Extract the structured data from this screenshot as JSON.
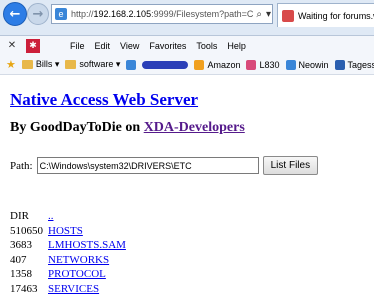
{
  "browser": {
    "url_prefix": "http://",
    "url_host": "192.168.2.105",
    "url_rest": ":9999/Filesystem?path=C",
    "tab_title": "Waiting for forums.windr"
  },
  "menu": {
    "items": [
      "File",
      "Edit",
      "View",
      "Favorites",
      "Tools",
      "Help"
    ]
  },
  "favorites": {
    "items": [
      {
        "label": "Bills ▾"
      },
      {
        "label": "software ▾"
      },
      {
        "label": "Amazon"
      },
      {
        "label": "L830"
      },
      {
        "label": "Neowin"
      },
      {
        "label": "Tagesscha"
      }
    ]
  },
  "page": {
    "title": "Native Access Web Server",
    "byline_prefix": "By GoodDayToDie on ",
    "byline_link": "XDA-Developers",
    "path_label": "Path:",
    "path_value": "C:\\Windows\\system32\\DRIVERS\\ETC",
    "list_button": "List Files"
  },
  "files": [
    {
      "size": "DIR",
      "name": ".."
    },
    {
      "size": "510650",
      "name": "HOSTS"
    },
    {
      "size": "3683",
      "name": "LMHOSTS.SAM"
    },
    {
      "size": "407",
      "name": "NETWORKS"
    },
    {
      "size": "1358",
      "name": "PROTOCOL"
    },
    {
      "size": "17463",
      "name": "SERVICES"
    }
  ],
  "colors": {
    "link": "#0000ee",
    "visited_link": "#551a8b",
    "chrome": "#dfe9f5"
  }
}
